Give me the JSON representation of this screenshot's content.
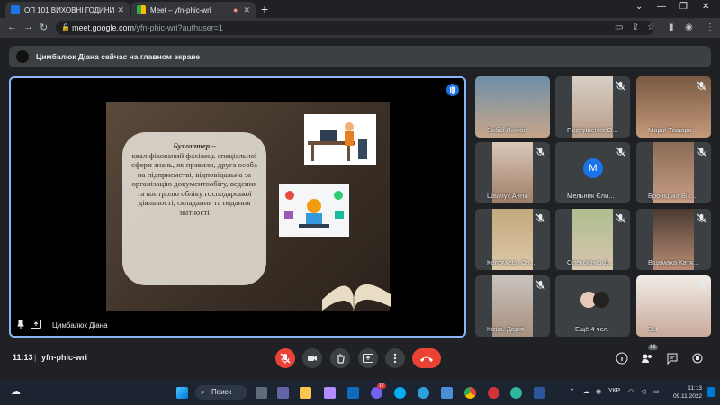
{
  "browser": {
    "tabs": [
      {
        "label": "ОП 101 ВИХОВНІ ГОДИНИ",
        "active": false,
        "favicon_color": "#1a73e8"
      },
      {
        "label": "Meet – yfn-phic-wri",
        "active": true,
        "favicon_color": "#34a853"
      }
    ],
    "new_tab": "+",
    "url_host": "meet.google.com",
    "url_path": "/yfn-phic-wri?authuser=1"
  },
  "banner": {
    "text": "Цимбалюк Діана сейчас на главном экране"
  },
  "presentation": {
    "title": "Бухгалтер –",
    "body": "кваліфікований фахівець спеціальної сфери знань, як правило, друга особа на підприємстві, відповідальна за організацію документообігу, ведення та контролю обліку господарської діяльності, складання та подання звітності",
    "presenter": "Цимбалюк Діана"
  },
  "participants": [
    {
      "name": "Бабій Любов",
      "type": "video",
      "muted": false
    },
    {
      "name": "Пастушенко О...",
      "type": "video",
      "muted": true
    },
    {
      "name": "Марій Тамара",
      "type": "video",
      "muted": true
    },
    {
      "name": "Швачук Анна",
      "type": "video",
      "muted": true
    },
    {
      "name": "Мельник Єли...",
      "type": "letter",
      "letter": "M",
      "muted": true
    },
    {
      "name": "Броніцька Вік...",
      "type": "video",
      "muted": true
    },
    {
      "name": "Коломієць Св...",
      "type": "video",
      "muted": true
    },
    {
      "name": "Олексієнко Д...",
      "type": "video",
      "muted": true
    },
    {
      "name": "Віцьмаха Катя...",
      "type": "video",
      "muted": true
    },
    {
      "name": "Кісіль Дарія",
      "type": "video",
      "muted": true
    },
    {
      "name": "Ещё 4 чел.",
      "type": "more",
      "muted": false
    },
    {
      "name": "Вы",
      "type": "video",
      "muted": true
    }
  ],
  "meeting": {
    "time": "11:13",
    "separator": "|",
    "code": "yfn-phic-wri",
    "participant_count": "16"
  },
  "taskbar": {
    "search_label": "Поиск",
    "language": "УКР",
    "clock_time": "11:13",
    "clock_date": "09.11.2022",
    "badge": "12"
  },
  "colors": {
    "accent": "#8ab4f8",
    "end_call": "#ea4335",
    "bg": "#202124"
  }
}
